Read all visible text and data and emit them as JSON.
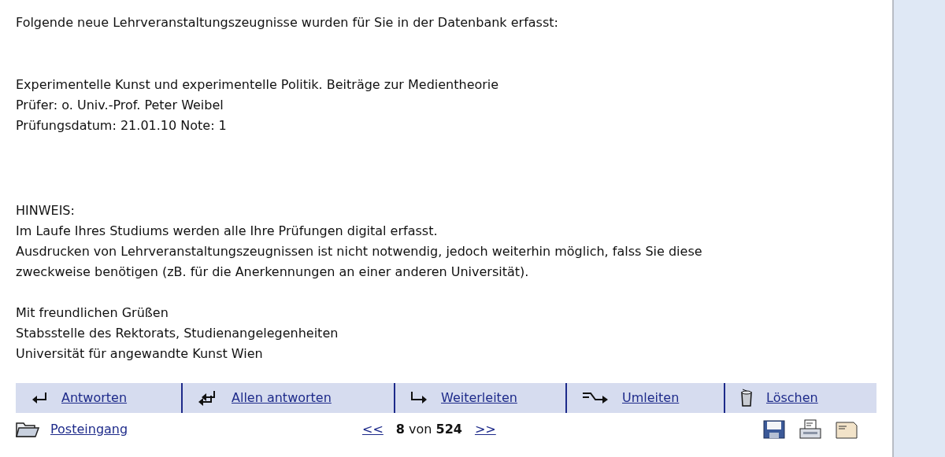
{
  "message": {
    "intro": "Folgende neue Lehrveranstaltungszeugnisse wurden für Sie in der Datenbank erfasst:",
    "exam": [
      "Experimentelle Kunst und experimentelle Politik. Beiträge zur Medientheorie",
      "Prüfer: o. Univ.-Prof. Peter Weibel",
      "Prüfungsdatum: 21.01.10 Note: 1"
    ],
    "notice": [
      "HINWEIS:",
      "Im Laufe Ihres Studiums werden alle Ihre Prüfungen digital erfasst.",
      "Ausdrucken von Lehrveranstaltungszeugnissen ist nicht notwendig, jedoch weiterhin möglich, falss Sie diese",
      "zweckweise benötigen (zB. für die Anerkennungen an einer anderen Universität)."
    ],
    "closing": [
      "Mit freundlichen Grüßen",
      "Stabsstelle des Rektorats, Studienangelegenheiten",
      "Universität für angewandte Kunst Wien"
    ]
  },
  "actions": [
    {
      "kind": "reply",
      "label": "Antworten"
    },
    {
      "kind": "reply_all",
      "label": "Allen antworten"
    },
    {
      "kind": "forward",
      "label": "Weiterleiten"
    },
    {
      "kind": "redirect",
      "label": "Umleiten"
    },
    {
      "kind": "delete",
      "label": "Löschen"
    }
  ],
  "footer": {
    "inbox": "Posteingang",
    "prev": "<<",
    "position": "**8** von **524**",
    "next": ">>",
    "tools": [
      {
        "kind": "save"
      },
      {
        "kind": "print"
      },
      {
        "kind": "source"
      }
    ]
  }
}
